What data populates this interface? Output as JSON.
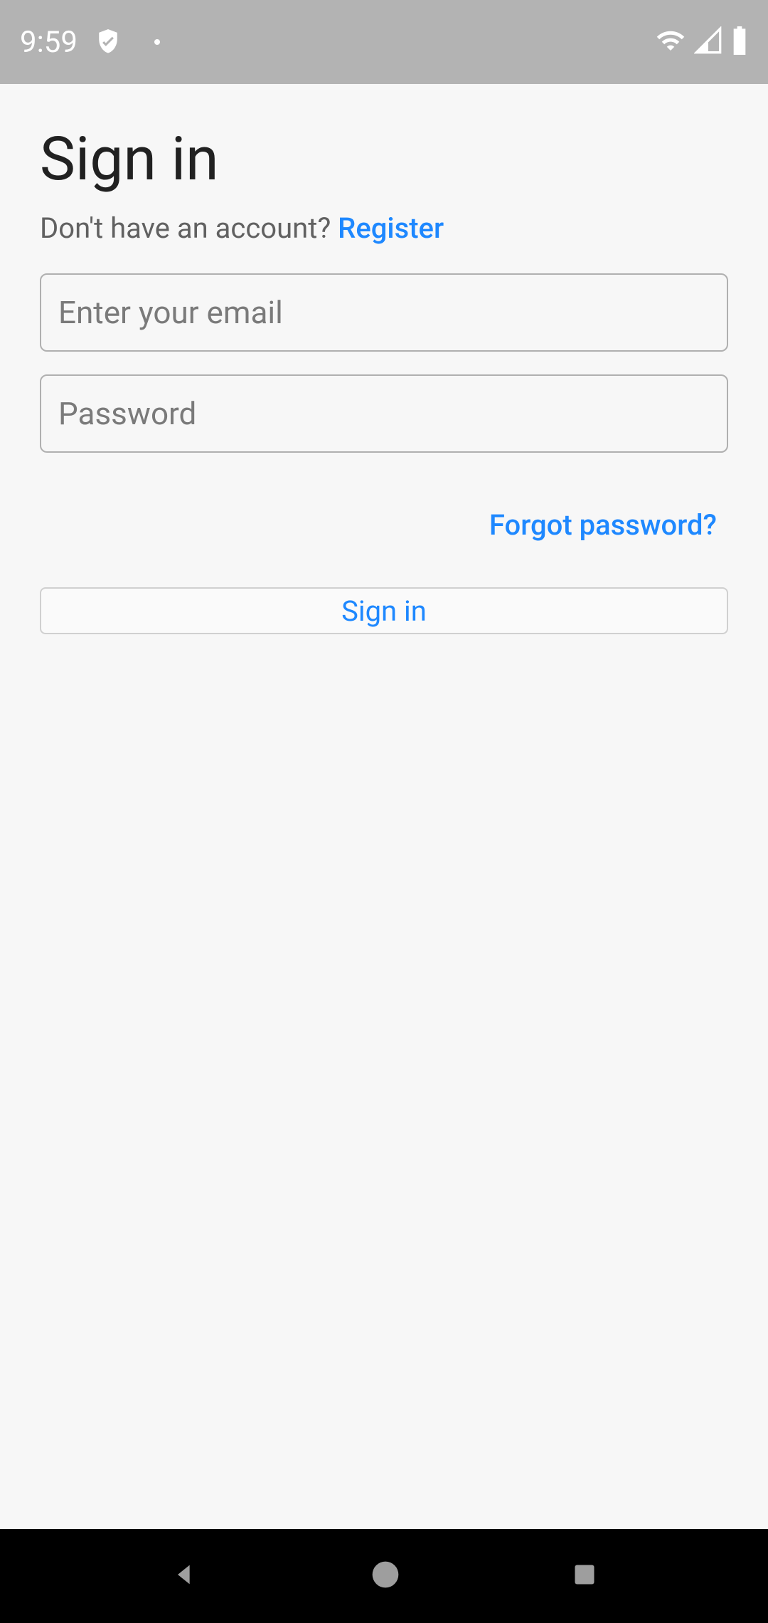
{
  "status_bar": {
    "time": "9:59"
  },
  "page": {
    "title": "Sign in",
    "register_prompt": "Don't have an account? ",
    "register_link": "Register",
    "email_placeholder": "Enter your email",
    "email_value": "",
    "password_placeholder": "Password",
    "password_value": "",
    "forgot_link": "Forgot password?",
    "signin_button": "Sign in"
  },
  "colors": {
    "accent": "#1e88ff",
    "bg": "#f7f7f7",
    "statusbar": "#b3b3b3"
  }
}
